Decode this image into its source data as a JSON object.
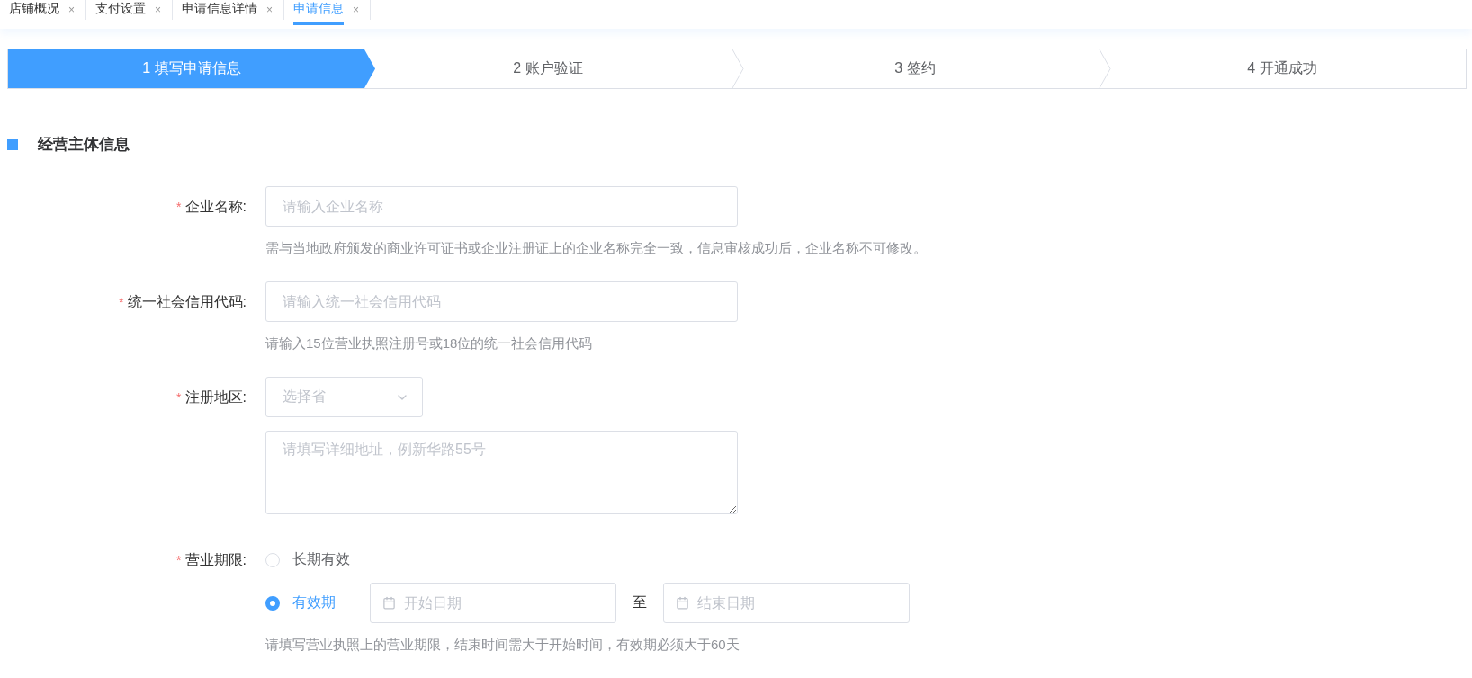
{
  "tabs": [
    {
      "label": "店铺概况",
      "close": "×",
      "selected": false
    },
    {
      "label": "支付设置",
      "close": "×",
      "selected": false
    },
    {
      "label": "申请信息详情",
      "close": "×",
      "selected": false
    },
    {
      "label": "申请信息",
      "close": "×",
      "selected": true
    }
  ],
  "steps": [
    {
      "label": "1 填写申请信息",
      "selected": true
    },
    {
      "label": "2 账户验证",
      "selected": false
    },
    {
      "label": "3 签约",
      "selected": false
    },
    {
      "label": "4 开通成功",
      "selected": false
    }
  ],
  "section": {
    "title": "经营主体信息"
  },
  "form": {
    "company_name": {
      "required_mark": "*",
      "label": "企业名称:",
      "placeholder": "请输入企业名称",
      "hint": "需与当地政府颁发的商业许可证书或企业注册证上的企业名称完全一致，信息审核成功后，企业名称不可修改。"
    },
    "credit_code": {
      "required_mark": "*",
      "label": "统一社会信用代码:",
      "placeholder": "请输入统一社会信用代码",
      "hint": "请输入15位营业执照注册号或18位的统一社会信用代码"
    },
    "region": {
      "required_mark": "*",
      "label": "注册地区:",
      "select_placeholder": "选择省",
      "address_placeholder": "请填写详细地址，例新华路55号"
    },
    "period": {
      "required_mark": "*",
      "label": "营业期限:",
      "options": [
        {
          "label": "长期有效",
          "selected": false
        },
        {
          "label": "有效期",
          "selected": true
        }
      ],
      "start_placeholder": "开始日期",
      "separator": "至",
      "end_placeholder": "结束日期",
      "hint": "请填写营业执照上的营业期限，结束时间需大于开始时间，有效期必须大于60天"
    }
  }
}
